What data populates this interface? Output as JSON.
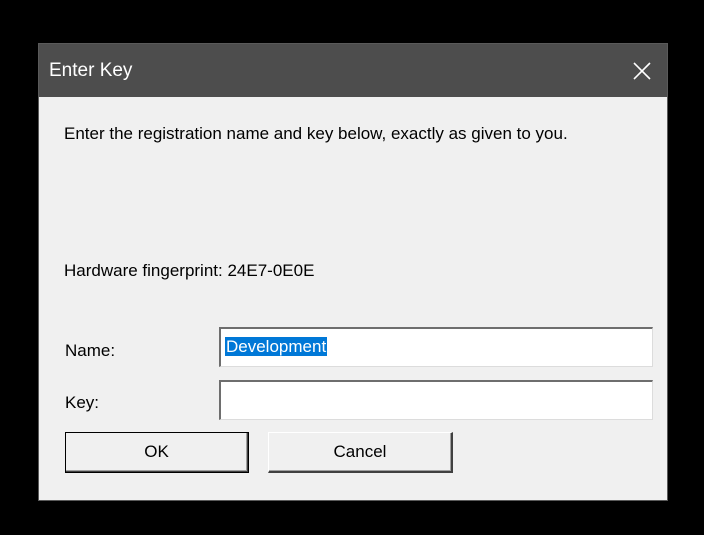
{
  "dialog": {
    "title": "Enter Key",
    "close_icon": "close-icon",
    "instruction": "Enter the registration name and key below, exactly as given to you.",
    "fingerprint_label": "Hardware fingerprint: 24E7-0E0E",
    "name_label": "Name:",
    "name_value": "Development",
    "key_label": "Key:",
    "key_value": "",
    "ok_label": "OK",
    "cancel_label": "Cancel"
  },
  "colors": {
    "titlebar": "#4d4d4d",
    "dialog_bg": "#f0f0f0",
    "selection": "#0078d7",
    "screen_bg": "#000000"
  }
}
